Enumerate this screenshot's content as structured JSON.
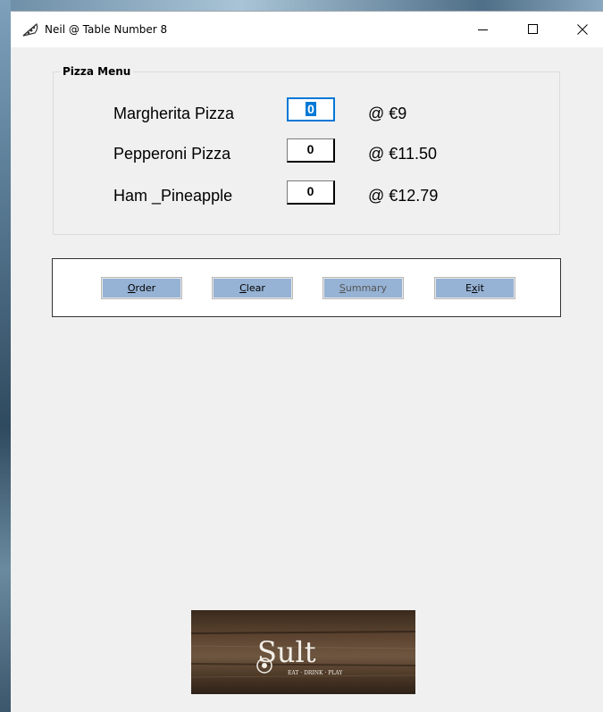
{
  "window": {
    "title": "Neil @ Table Number 8",
    "icon": "pizza-slice-icon"
  },
  "controls": {
    "minimize": "minimize-icon",
    "maximize": "maximize-icon",
    "close": "close-icon"
  },
  "menu": {
    "group_label": "Pizza Menu",
    "items": [
      {
        "name": "Margherita Pizza",
        "qty": "0",
        "price": "@ €9"
      },
      {
        "name": "Pepperoni Pizza",
        "qty": "0",
        "price": "@ €11.50"
      },
      {
        "name": "Ham _Pineapple",
        "qty": "0",
        "price": "@ €12.79"
      }
    ]
  },
  "buttons": {
    "order": {
      "mnemonic": "O",
      "rest": "rder"
    },
    "clear": {
      "mnemonic": "C",
      "rest": "lear"
    },
    "summary": {
      "mnemonic": "S",
      "rest": "ummary"
    },
    "exit": {
      "pre": "E",
      "mnemonic": "x",
      "rest": "it"
    }
  },
  "logo": {
    "brand": "Sult",
    "tagline": "EAT · DRINK · PLAY"
  },
  "colors": {
    "button_bg": "#96b2d4",
    "focus_accent": "#0078d7"
  }
}
